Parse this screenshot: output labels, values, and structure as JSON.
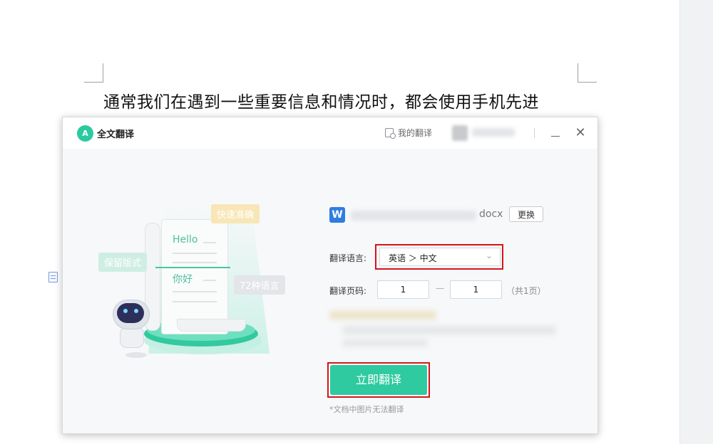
{
  "document": {
    "text_line": "通常我们在遇到一些重要信息和情况时，都会使用手机先进"
  },
  "dialog": {
    "app_logo_text": "A",
    "app_title": "全文翻译",
    "my_translations": "我的翻译",
    "close_glyph": "✕",
    "illustration": {
      "tag_accurate": "快速准确",
      "tag_format": "保留版式",
      "tag_languages": "72种语言",
      "hello": "Hello",
      "nihao": "你好"
    },
    "file": {
      "icon_letter": "W",
      "extension": "docx",
      "change_button": "更换"
    },
    "language": {
      "label": "翻译语言:",
      "value": "英语 ＞ 中文",
      "chevron": "⌄"
    },
    "pages": {
      "label": "翻译页码:",
      "from": "1",
      "to": "1",
      "separator": "—",
      "total": "（共1页）"
    },
    "translate_button": "立即翻译",
    "note": "*文档中图片无法翻译"
  },
  "colors": {
    "accent": "#2fcaa0",
    "highlight": "#d7141a",
    "word_blue": "#2e7de0"
  }
}
